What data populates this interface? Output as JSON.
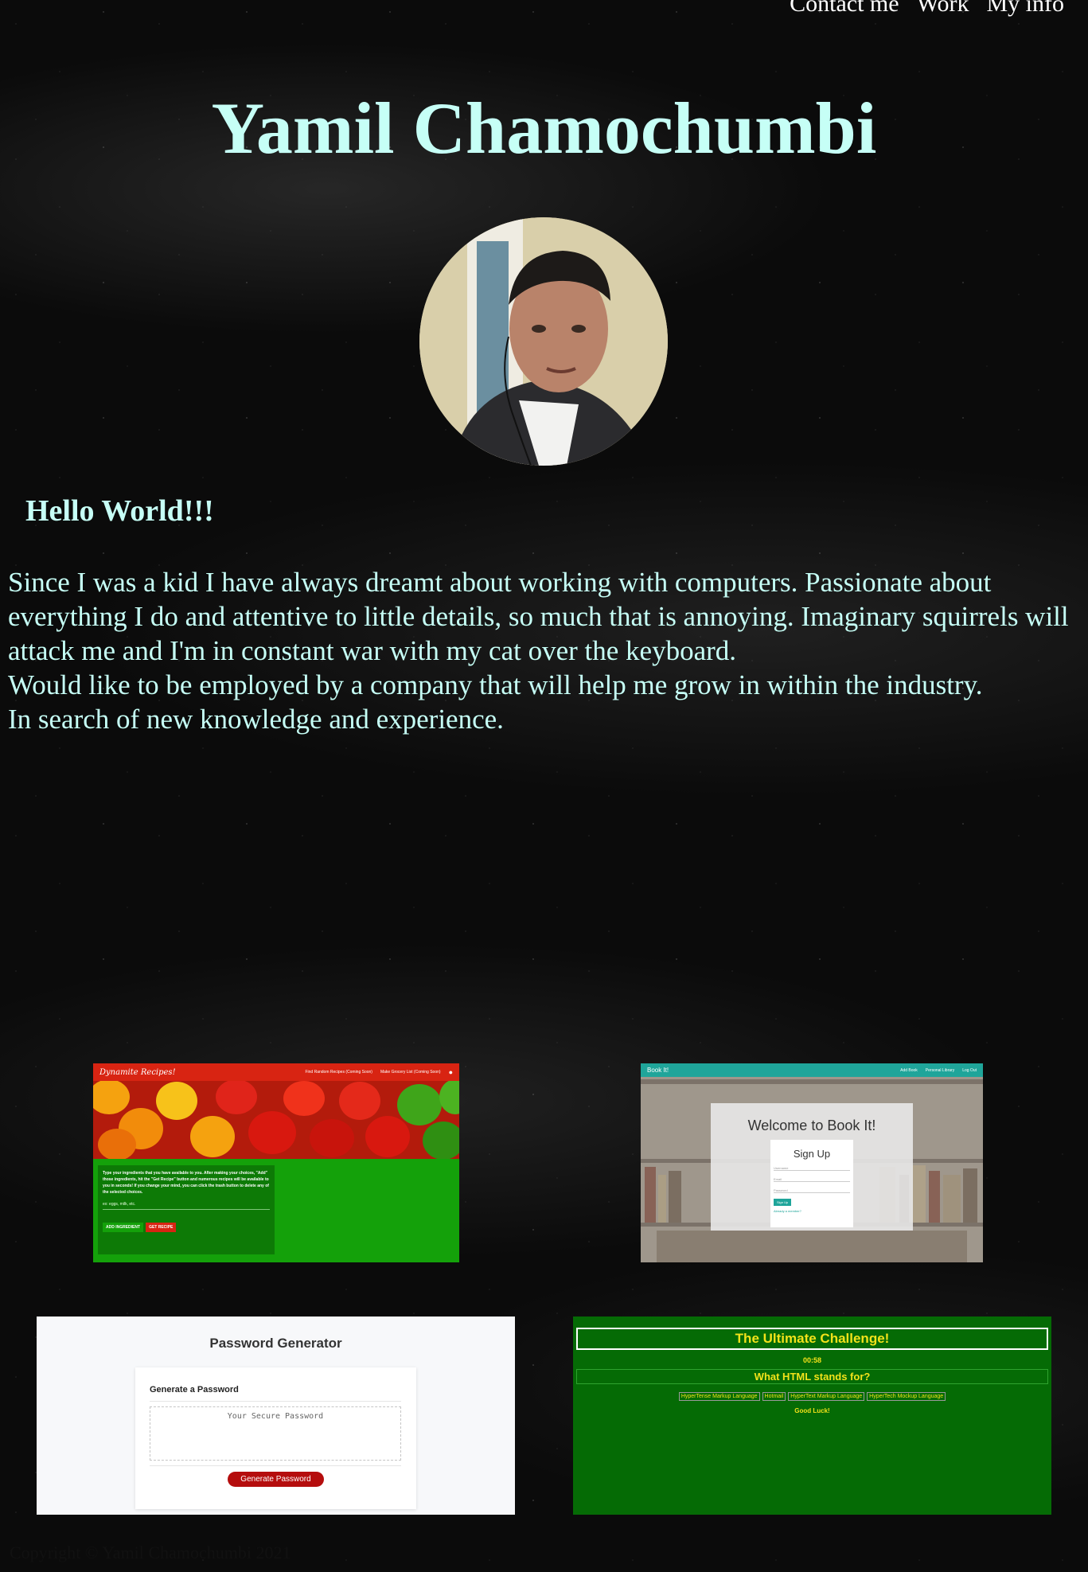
{
  "nav": [
    "Contact me",
    "Work",
    "My info"
  ],
  "header": {
    "title": "Yamil Chamochumbi"
  },
  "intro": {
    "greeting": "Hello World!!!",
    "bio": [
      "Since I was a kid I have always dreamt about working with computers. Passionate about everything I do and attentive to little details, so much that is annoying. Imaginary squirrels will attack me and I'm in constant war with my cat over the keyboard.",
      "Would like to be employed by a company that will help me grow in within the industry.",
      "In search of new knowledge and experience."
    ]
  },
  "projects": {
    "dynamite": {
      "brand": "Dynamite Recipes!",
      "nav1": "Find Random Recipes (Coming Soon)",
      "nav2": "Make Grocery List (Coming Soon)",
      "desc": "Type your ingredients that you have available to you. After making your choices, \"Add\" those ingredients, hit the \"Get Recipe\" button and numerous recipes will be available to you in seconds! If you change your mind, you can click the trash button to delete any of the selected choices.",
      "placeholder": "ex: eggs, milk, etc.",
      "add_btn": "ADD INGREDIENT",
      "get_btn": "GET RECIPE"
    },
    "bookit": {
      "brand": "Book It!",
      "nav": [
        "Add Book",
        "Personal Library",
        "Log Out"
      ],
      "heading": "Welcome to Book It!",
      "form_title": "Sign Up",
      "fields": [
        "Username",
        "Email",
        "Password"
      ],
      "button": "Sign Up",
      "link": "Already a member?"
    },
    "password": {
      "title": "Password Generator",
      "card_title": "Generate a Password",
      "placeholder": "Your Secure Password",
      "button": "Generate Password"
    },
    "quiz": {
      "title": "The Ultimate Challenge!",
      "timer": "00:58",
      "question": "What HTML stands for?",
      "answers": [
        "HyperTense Markup Language",
        "Hotmail",
        "HyperText Markup Language",
        "HyperTech Mockup Language"
      ],
      "message": "Good Luck!"
    }
  },
  "footer": {
    "text": "Copyright © Yamil Chamochumbi 2021"
  },
  "colors": {
    "accent": "#c6fff6",
    "recipe_red": "#d82412",
    "recipe_green": "#14a10a",
    "quiz_green": "#056b05",
    "quiz_yellow": "#f2e21a",
    "teal": "#1fa59a"
  }
}
